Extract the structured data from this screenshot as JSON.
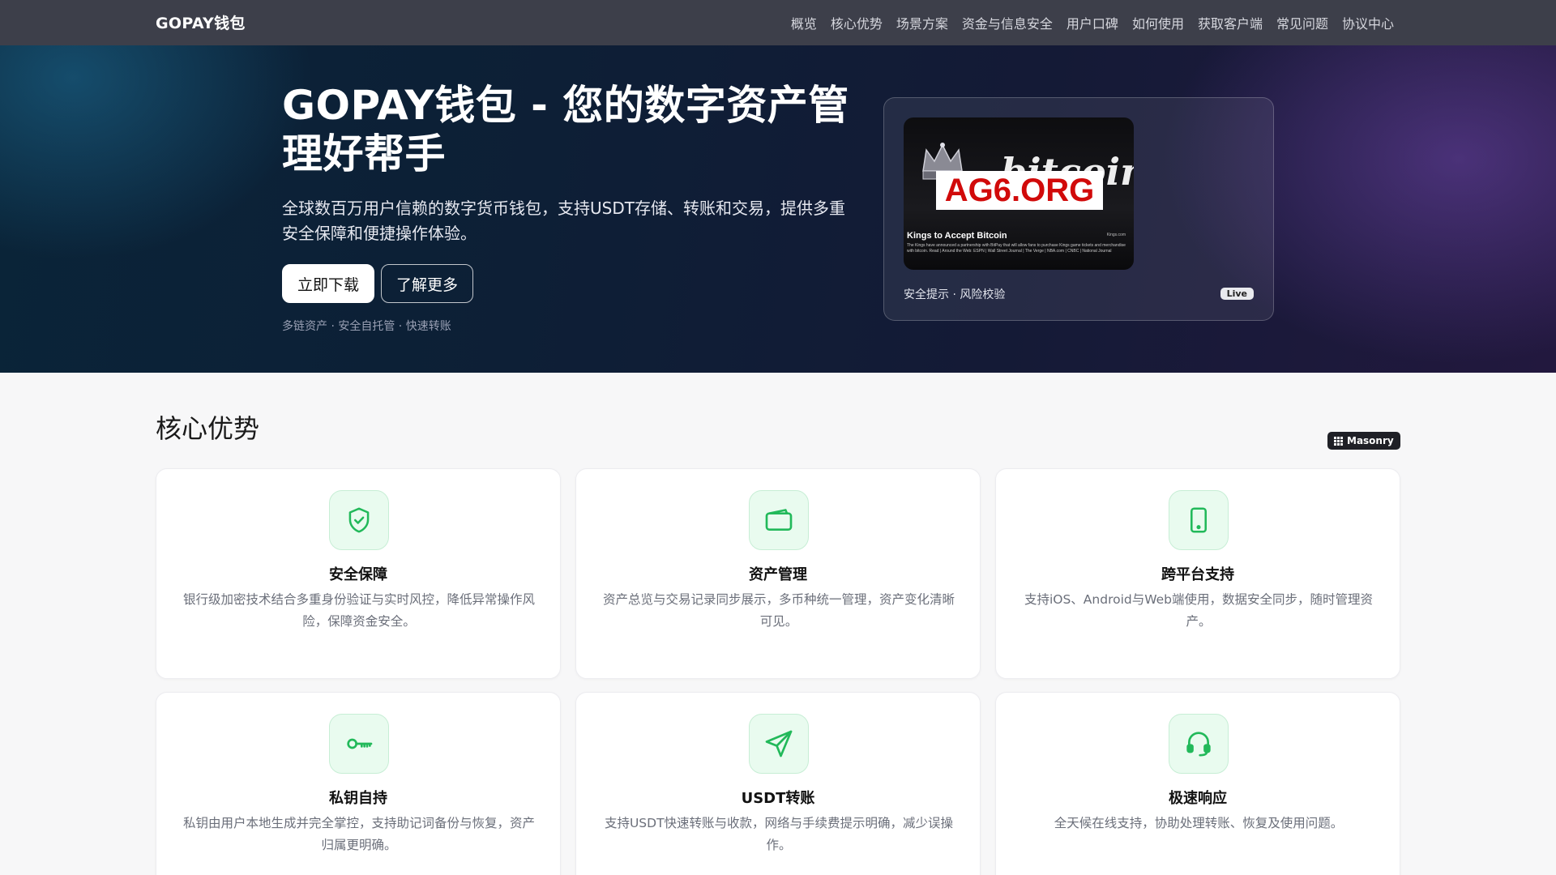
{
  "nav": {
    "brand": "GOPAY钱包",
    "links": [
      "概览",
      "核心优势",
      "场景方案",
      "资金与信息安全",
      "用户口碑",
      "如何使用",
      "获取客户端",
      "常见问题",
      "协议中心"
    ]
  },
  "hero": {
    "title": "GOPAY钱包 - 您的数字资产管理好帮手",
    "subtitle": "全球数百万用户信赖的数字货币钱包，支持USDT存储、转账和交易，提供多重安全保障和便捷操作体验。",
    "primary_button": "立即下载",
    "secondary_button": "了解更多",
    "tags": "多链资产 · 安全自托管 · 快速转账",
    "media_card": {
      "thumb_word": "bitcoin",
      "thumb_stamp": "AG6.ORG",
      "thumb_headline": "Kings to Accept Bitcoin",
      "thumb_body": "The Kings have announced a partnership with BitPay that will allow fans to purchase Kings game tickets and merchandise with bitcoin. Read | Around the Web: ESPN | Wall Street Journal | The Verge | NBA.com | CNBC | National Journal",
      "thumb_source": "Kings.com",
      "caption": "安全提示 · 风险校验",
      "badge": "Live"
    }
  },
  "section": {
    "title": "核心优势",
    "badge": "Masonry"
  },
  "features": [
    {
      "icon": "shield-check-icon",
      "title": "安全保障",
      "desc": "银行级加密技术结合多重身份验证与实时风控，降低异常操作风险，保障资金安全。"
    },
    {
      "icon": "wallet-icon",
      "title": "资产管理",
      "desc": "资产总览与交易记录同步展示，多币种统一管理，资产变化清晰可见。"
    },
    {
      "icon": "tablet-icon",
      "title": "跨平台支持",
      "desc": "支持iOS、Android与Web端使用，数据安全同步，随时管理资产。"
    },
    {
      "icon": "key-icon",
      "title": "私钥自持",
      "desc": "私钥由用户本地生成并完全掌控，支持助记词备份与恢复，资产归属更明确。"
    },
    {
      "icon": "send-icon",
      "title": "USDT转账",
      "desc": "支持USDT快速转账与收款，网络与手续费提示明确，减少误操作。"
    },
    {
      "icon": "headset-icon",
      "title": "极速响应",
      "desc": "全天候在线支持，协助处理转账、恢复及使用问题。"
    }
  ],
  "colors": {
    "nav_bg": "#3d3f4a",
    "accent_green": "#22b95a",
    "icon_bg": "#e9fbef",
    "stamp_red": "#d10a0a"
  }
}
